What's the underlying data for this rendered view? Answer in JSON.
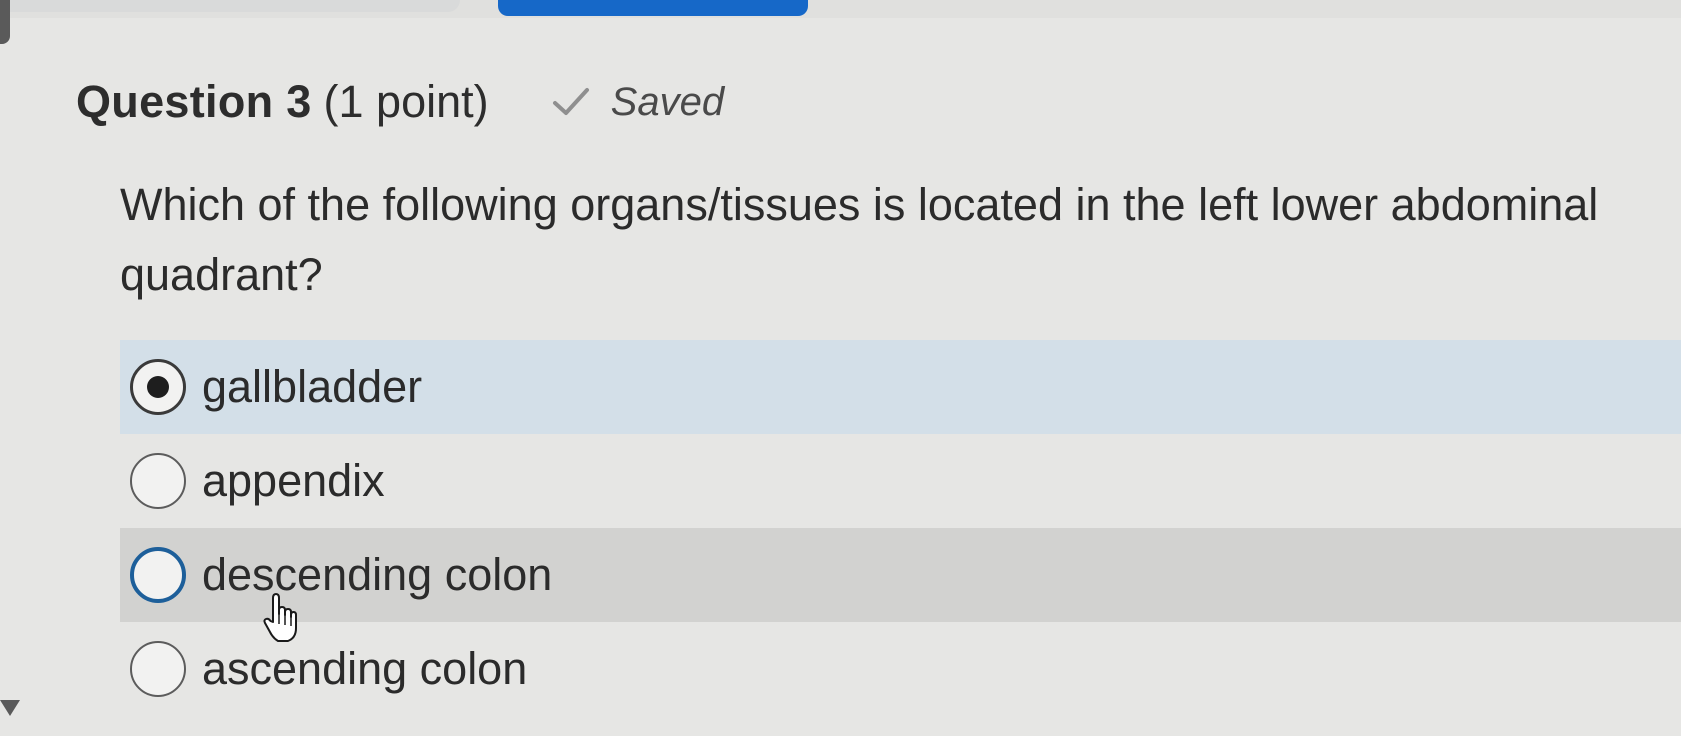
{
  "question": {
    "title": "Question 3",
    "points": "(1 point)",
    "status": "Saved",
    "status_icon": "check-icon",
    "prompt": "Which of the following organs/tissues is located in the left lower abdominal quadrant?"
  },
  "options": [
    {
      "label": "gallbladder",
      "selected": true
    },
    {
      "label": "appendix",
      "selected": false
    },
    {
      "label": "descending colon",
      "selected": false,
      "hovered": true
    },
    {
      "label": "ascending colon",
      "selected": false
    }
  ],
  "colors": {
    "accent": "#1668c8",
    "selected_row": "#d3dfe8",
    "hover_row": "#d2d2d0",
    "background": "#e6e6e4"
  }
}
